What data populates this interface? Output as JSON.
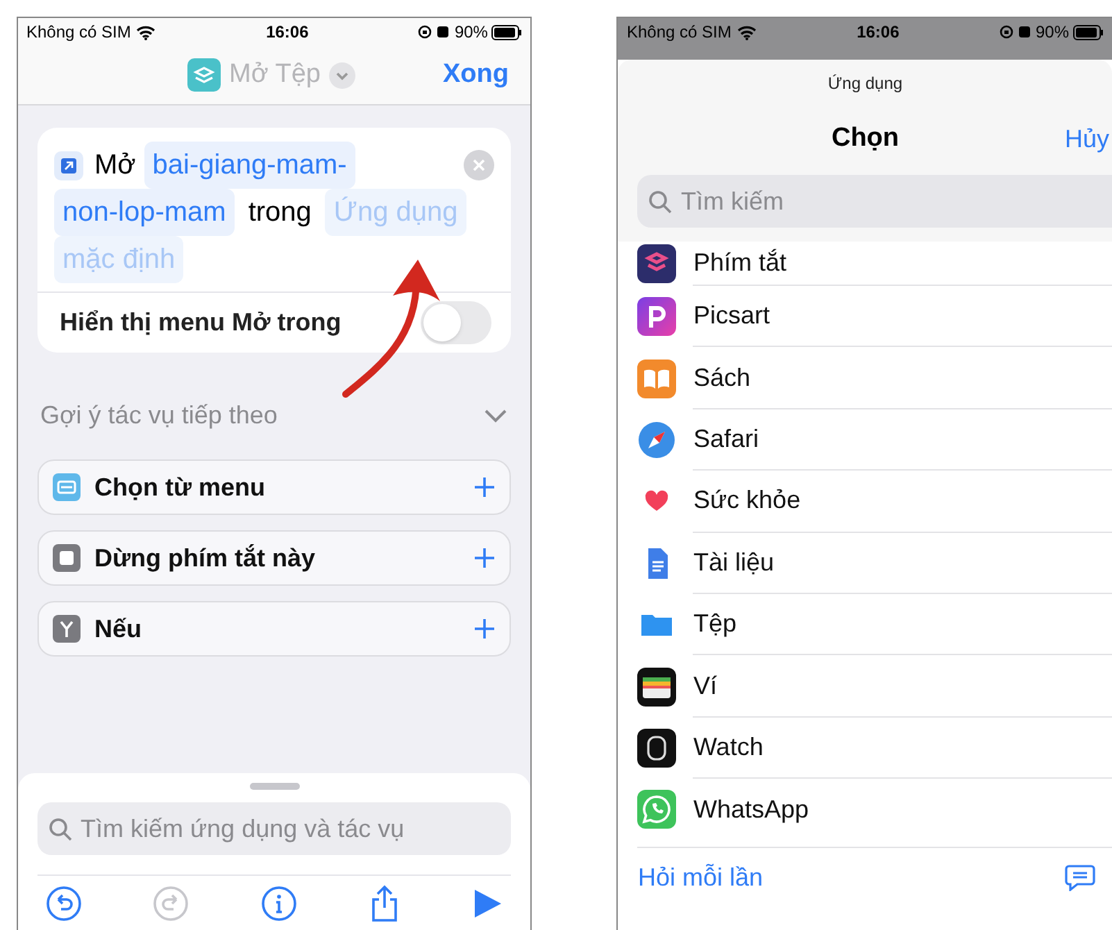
{
  "left_phone": {
    "status_bar": {
      "carrier": "Không có SIM",
      "time": "16:06",
      "battery": "90%"
    },
    "nav": {
      "title": "Mở Tệp",
      "done": "Xong"
    },
    "action": {
      "verb": "Mở",
      "file_lines": [
        "bai-giang-mam-",
        "non-lop-mam"
      ],
      "connector": "trong",
      "app_placeholder_lines": [
        "Ứng dụng",
        "mặc định"
      ],
      "toggle_label": "Hiển thị menu Mở trong",
      "toggle_on": false
    },
    "suggestions": {
      "title": "Gợi ý tác vụ tiếp theo",
      "items": [
        {
          "label": "Chọn từ menu",
          "kind": "menu"
        },
        {
          "label": "Dừng phím tắt này",
          "kind": "stop"
        },
        {
          "label": "Nếu",
          "kind": "if"
        }
      ]
    },
    "search": {
      "placeholder": "Tìm kiếm ứng dụng và tác vụ"
    }
  },
  "right_phone": {
    "status_bar": {
      "carrier": "Không có SIM",
      "time": "16:06",
      "battery": "90%"
    },
    "sheet": {
      "subtitle": "Ứng dụng",
      "title": "Chọn",
      "cancel": "Hủy",
      "search": {
        "placeholder": "Tìm kiếm"
      },
      "apps": [
        {
          "name": "Phím tắt",
          "kind": "shortcuts"
        },
        {
          "name": "Picsart",
          "kind": "picsart"
        },
        {
          "name": "Sách",
          "kind": "books"
        },
        {
          "name": "Safari",
          "kind": "safari"
        },
        {
          "name": "Sức khỏe",
          "kind": "health"
        },
        {
          "name": "Tài liệu",
          "kind": "docs"
        },
        {
          "name": "Tệp",
          "kind": "files"
        },
        {
          "name": "Ví",
          "kind": "wallet"
        },
        {
          "name": "Watch",
          "kind": "watch"
        },
        {
          "name": "WhatsApp",
          "kind": "whatsapp"
        }
      ],
      "footer": "Hỏi mỗi lần"
    }
  }
}
